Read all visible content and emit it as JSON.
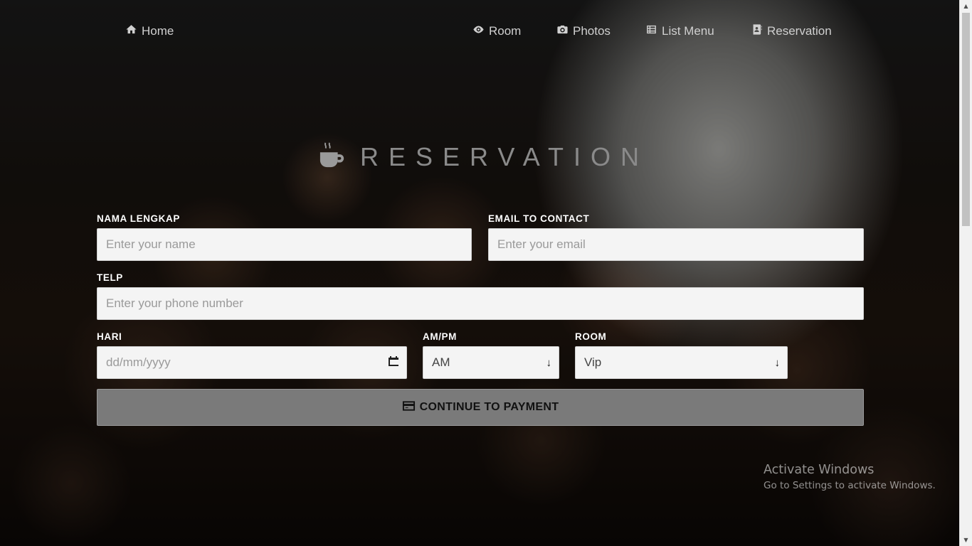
{
  "nav": {
    "home": {
      "label": "Home",
      "icon": "home-icon"
    },
    "room": {
      "label": "Room",
      "icon": "eye-icon"
    },
    "photos": {
      "label": "Photos",
      "icon": "camera-icon"
    },
    "list_menu": {
      "label": "List Menu",
      "icon": "list-icon"
    },
    "reservation": {
      "label": "Reservation",
      "icon": "address-card-icon"
    }
  },
  "header": {
    "title": "RESERVATION",
    "icon": "coffee-cup-icon"
  },
  "form": {
    "name": {
      "label": "NAMA LENGKAP",
      "placeholder": "Enter your name",
      "value": ""
    },
    "email": {
      "label": "EMAIL TO CONTACT",
      "placeholder": "Enter your email",
      "value": ""
    },
    "telp": {
      "label": "TELP",
      "placeholder": "Enter your phone number",
      "value": ""
    },
    "hari": {
      "label": "HARI",
      "placeholder": "dd/mm/yyyy",
      "value": ""
    },
    "ampm": {
      "label": "AM/PM",
      "value": "AM"
    },
    "room": {
      "label": "ROOM",
      "value": "Vip"
    },
    "submit_label": "CONTINUE TO PAYMENT"
  },
  "watermark": {
    "title": "Activate Windows",
    "subtitle": "Go to Settings to activate Windows."
  },
  "colors": {
    "submit_bg": "#7a7a7a",
    "field_bg": "#f4f4f4",
    "label": "#ffffff",
    "nav_text": "#d0d0d0"
  }
}
